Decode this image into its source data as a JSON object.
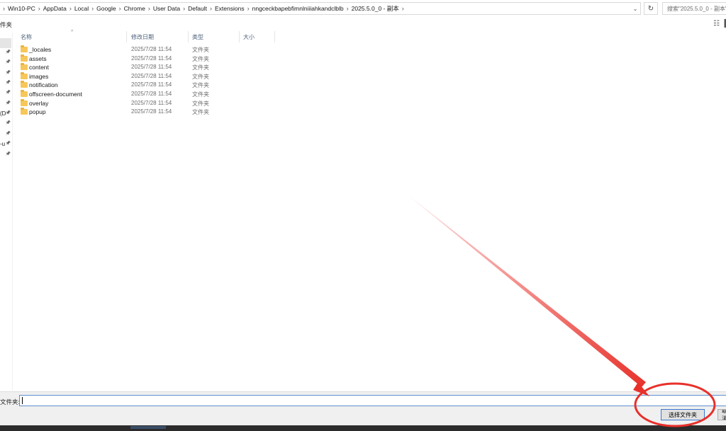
{
  "address_bar": {
    "crumbs": [
      "Win10-PC",
      "AppData",
      "Local",
      "Google",
      "Chrome",
      "User Data",
      "Default",
      "Extensions",
      "nngceckbapebfimnlniiiahkandclblb",
      "2025.5.0_0 - 副本"
    ],
    "search_placeholder": "搜索\"2025.5.0_0 - 副本\""
  },
  "toolbar": {
    "new_folder_label": "件夹"
  },
  "nav_pane": {
    "items": [
      {
        "label": ""
      },
      {
        "label": ""
      },
      {
        "label": ""
      },
      {
        "label": ""
      },
      {
        "label": ""
      },
      {
        "label": ""
      },
      {
        "label": "(D"
      },
      {
        "label": ""
      },
      {
        "label": ""
      },
      {
        "label": "-u"
      },
      {
        "label": ""
      }
    ]
  },
  "file_list": {
    "columns": {
      "name": "名称",
      "date": "修改日期",
      "type": "类型",
      "size": "大小"
    },
    "rows": [
      {
        "name": "_locales",
        "date": "2025/7/28 11:54",
        "type": "文件夹"
      },
      {
        "name": "assets",
        "date": "2025/7/28 11:54",
        "type": "文件夹"
      },
      {
        "name": "content",
        "date": "2025/7/28 11:54",
        "type": "文件夹"
      },
      {
        "name": "images",
        "date": "2025/7/28 11:54",
        "type": "文件夹"
      },
      {
        "name": "notification",
        "date": "2025/7/28 11:54",
        "type": "文件夹"
      },
      {
        "name": "offscreen-document",
        "date": "2025/7/28 11:54",
        "type": "文件夹"
      },
      {
        "name": "overlay",
        "date": "2025/7/28 11:54",
        "type": "文件夹"
      },
      {
        "name": "popup",
        "date": "2025/7/28 11:54",
        "type": "文件夹"
      }
    ]
  },
  "bottom": {
    "folder_label": "文件夹:",
    "folder_value": "",
    "select_button": "选择文件夹",
    "cancel_button": "取消"
  },
  "colors": {
    "annotation_red": "#e8302a",
    "folder_yellow": "#f7c75b",
    "accent_blue": "#3b78d4"
  },
  "icons": [
    "refresh-icon",
    "chevron-down-icon",
    "pin-icon",
    "folder-icon",
    "view-options-icon",
    "help-icon"
  ]
}
